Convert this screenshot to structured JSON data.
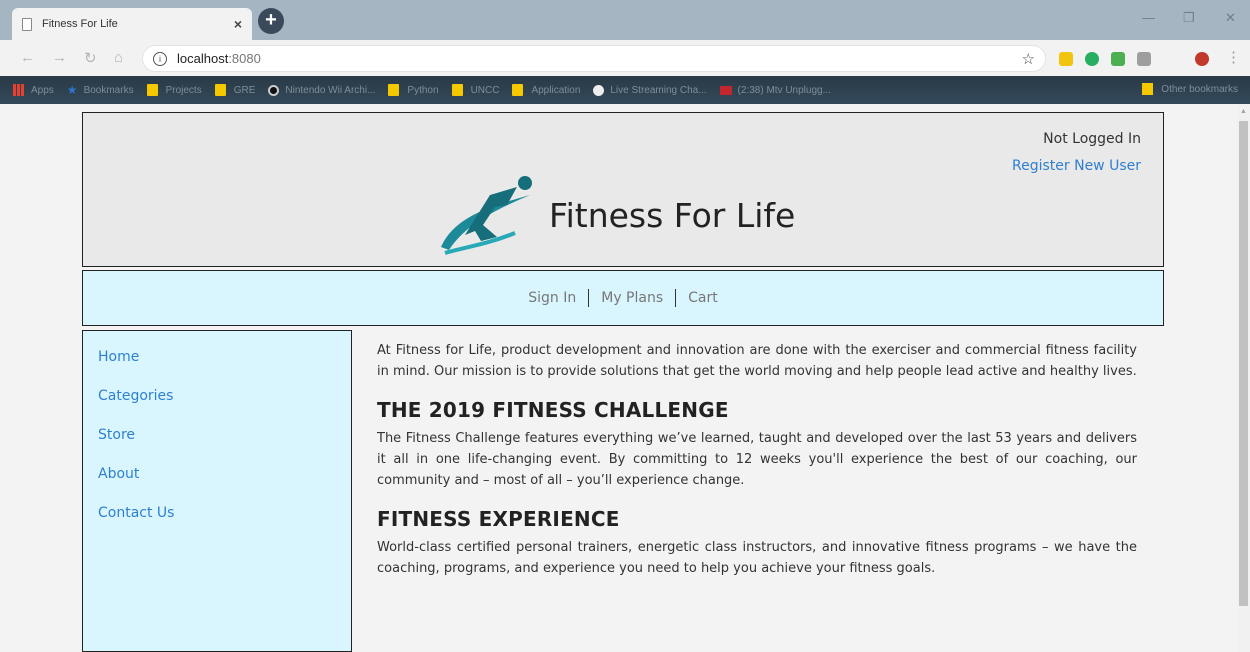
{
  "browser": {
    "tab_title": "Fitness For Life",
    "tab_close": "×",
    "new_tab": "+",
    "url_host": "localhost",
    "url_port": ":8080",
    "window_controls": [
      "—",
      "❐",
      "✕"
    ],
    "bookmarks": [
      {
        "label": "Apps",
        "icon": "apps-icon"
      },
      {
        "label": "Bookmarks",
        "icon": "star-icon"
      },
      {
        "label": "Projects",
        "icon": "folder-icon"
      },
      {
        "label": "GRE",
        "icon": "folder-icon"
      },
      {
        "label": "Nintendo Wii Archi...",
        "icon": "wii-icon"
      },
      {
        "label": "Python",
        "icon": "folder-icon"
      },
      {
        "label": "UNCC",
        "icon": "folder-icon"
      },
      {
        "label": "Application",
        "icon": "folder-icon"
      },
      {
        "label": "Live Streaming Cha...",
        "icon": "soccer-ball-icon"
      },
      {
        "label": "(2:38) Mtv Unplugg...",
        "icon": "youtube-icon"
      }
    ],
    "other_bookmarks": "Other bookmarks"
  },
  "header": {
    "login_status": "Not Logged In",
    "register_link": "Register New User",
    "brand_title": "Fitness For Life"
  },
  "nav": {
    "items": [
      "Sign In",
      "My Plans",
      "Cart"
    ]
  },
  "sidebar": {
    "items": [
      "Home",
      "Categories",
      "Store",
      "About",
      "Contact Us"
    ]
  },
  "content": {
    "intro": "At Fitness for Life, product development and innovation are done with the exerciser and commercial fitness facility in mind. Our mission is to provide solutions that get the world moving and help people lead active and healthy lives.",
    "sections": [
      {
        "heading": "THE 2019 FITNESS CHALLENGE",
        "body": "The Fitness Challenge features everything we’ve learned, taught and developed over the last 53 years and delivers it all in one life-changing event. By committing to 12 weeks you'll experience the best of our coaching, our community and – most of all – you’ll experience change."
      },
      {
        "heading": "FITNESS EXPERIENCE",
        "body": "World-class certified personal trainers, energetic class instructors, and innovative fitness programs – we have the coaching, programs, and experience you need to help you achieve your fitness goals."
      }
    ]
  },
  "colors": {
    "header_bg": "#e9e9e9",
    "nav_bg": "#d9f6ff",
    "link": "#2f7fcf",
    "logo_teal": "#1d8a99"
  }
}
